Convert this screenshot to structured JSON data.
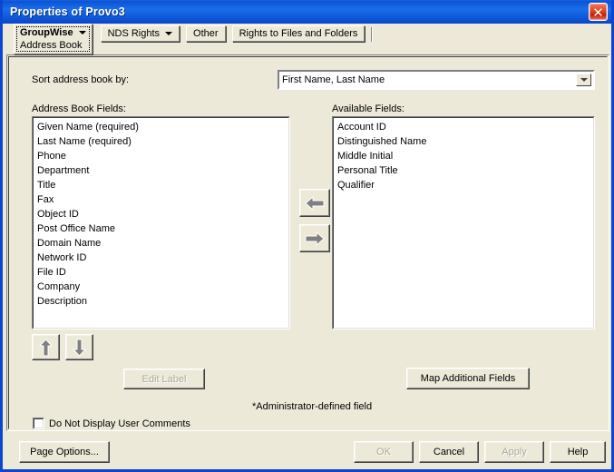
{
  "window": {
    "title": "Properties of Provo3",
    "close_label": "Close",
    "close_icon": "close-icon"
  },
  "tabs": [
    {
      "label": "GroupWise",
      "sublabel": "Address Book",
      "selected": true,
      "has_dropdown": true
    },
    {
      "label": "NDS Rights",
      "selected": false,
      "has_dropdown": true
    },
    {
      "label": "Other",
      "selected": false,
      "has_dropdown": false
    },
    {
      "label": "Rights to Files and Folders",
      "selected": false,
      "has_dropdown": false
    }
  ],
  "sort": {
    "label": "Sort address book by:",
    "value": "First Name, Last Name",
    "dropdown_icon": "chevron-down-icon"
  },
  "address_book_fields": {
    "label": "Address Book Fields:",
    "items": [
      "Given Name (required)",
      "Last Name (required)",
      "Phone",
      "Department",
      "Title",
      "Fax",
      "Object ID",
      "Post Office Name",
      "Domain Name",
      "Network ID",
      "File ID",
      "Company",
      "Description"
    ]
  },
  "available_fields": {
    "label": "Available Fields:",
    "items": [
      "Account ID",
      "Distinguished Name",
      "Middle Initial",
      "Personal Title",
      "Qualifier"
    ]
  },
  "transfer_buttons": {
    "add_icon": "arrow-left-icon",
    "remove_icon": "arrow-right-icon"
  },
  "order_buttons": {
    "up_icon": "arrow-up-icon",
    "down_icon": "arrow-down-icon"
  },
  "actions": {
    "edit_label": "Edit Label",
    "edit_label_enabled": false,
    "map_additional_fields": "Map Additional Fields",
    "map_additional_fields_enabled": true
  },
  "notes": {
    "administrator_defined": "*Administrator-defined field"
  },
  "checkbox": {
    "label": "Do Not Display User Comments",
    "checked": false
  },
  "footer": {
    "page_options": "Page Options...",
    "page_options_mnemonic": "g",
    "ok": "OK",
    "ok_enabled": false,
    "cancel": "Cancel",
    "cancel_enabled": true,
    "apply": "Apply",
    "apply_enabled": false,
    "help": "Help",
    "help_enabled": true
  },
  "colors": {
    "titlebar_blue": "#0f5ae0",
    "frame_blue": "#0a46d2",
    "dialog_face": "#ece9d8",
    "listbox_bg": "#ffffff",
    "disabled_text": "#aca899",
    "close_red": "#c5200c"
  }
}
